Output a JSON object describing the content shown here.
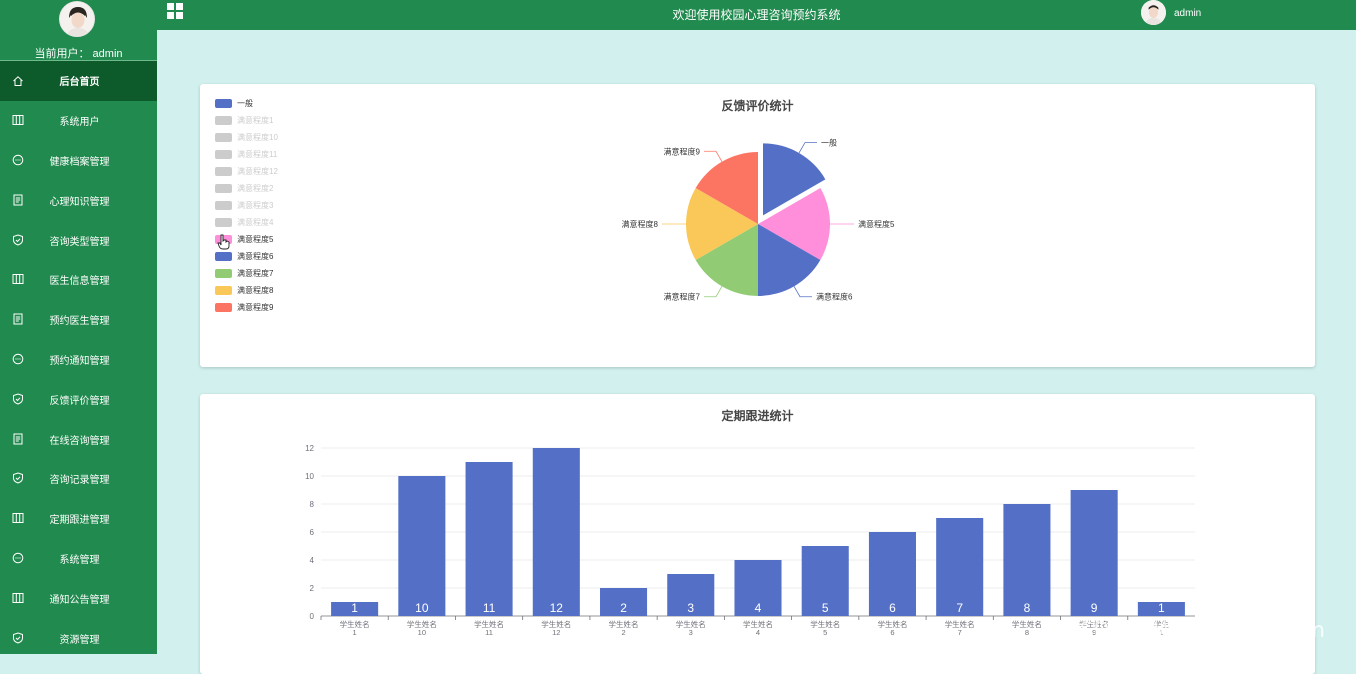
{
  "sidebar": {
    "current_user_label": "当前用户：",
    "current_user_name": "admin",
    "items": [
      {
        "label": "后台首页",
        "icon": "home-icon",
        "active": true
      },
      {
        "label": "系统用户",
        "icon": "columns-icon"
      },
      {
        "label": "健康档案管理",
        "icon": "chat-icon"
      },
      {
        "label": "心理知识管理",
        "icon": "document-icon"
      },
      {
        "label": "咨询类型管理",
        "icon": "shield-icon"
      },
      {
        "label": "医生信息管理",
        "icon": "columns-icon"
      },
      {
        "label": "预约医生管理",
        "icon": "document-icon"
      },
      {
        "label": "预约通知管理",
        "icon": "chat-icon"
      },
      {
        "label": "反馈评价管理",
        "icon": "shield-icon"
      },
      {
        "label": "在线咨询管理",
        "icon": "document-icon"
      },
      {
        "label": "咨询记录管理",
        "icon": "shield-icon"
      },
      {
        "label": "定期跟进管理",
        "icon": "columns-icon"
      },
      {
        "label": "系统管理",
        "icon": "chat-icon"
      },
      {
        "label": "通知公告管理",
        "icon": "columns-icon"
      },
      {
        "label": "资源管理",
        "icon": "shield-icon"
      }
    ]
  },
  "header": {
    "title": "欢迎使用校园心理咨询预约系统",
    "user": "admin"
  },
  "colors": {
    "brand": "#218a4f",
    "brand_dark": "#0d5a2a",
    "background": "#d1f0ee",
    "legend_off": "#cccccc"
  },
  "chart_data": [
    {
      "type": "pie",
      "title": "反馈评价统计",
      "legend_position": "top-left",
      "legend": [
        {
          "name": "一般",
          "color": "#5470c6",
          "active": true
        },
        {
          "name": "满意程度1",
          "color": "#cccccc",
          "active": false
        },
        {
          "name": "满意程度10",
          "color": "#cccccc",
          "active": false
        },
        {
          "name": "满意程度11",
          "color": "#cccccc",
          "active": false
        },
        {
          "name": "满意程度12",
          "color": "#cccccc",
          "active": false
        },
        {
          "name": "满意程度2",
          "color": "#cccccc",
          "active": false
        },
        {
          "name": "满意程度3",
          "color": "#cccccc",
          "active": false
        },
        {
          "name": "满意程度4",
          "color": "#cccccc",
          "active": false
        },
        {
          "name": "满意程度5",
          "color": "#ff8fdb",
          "active": true
        },
        {
          "name": "满意程度6",
          "color": "#5470c6",
          "active": true
        },
        {
          "name": "满意程度7",
          "color": "#91cc75",
          "active": true
        },
        {
          "name": "满意程度8",
          "color": "#fac858",
          "active": true
        },
        {
          "name": "满意程度9",
          "color": "#fc7563",
          "active": true
        }
      ],
      "slices": [
        {
          "name": "一般",
          "value": 1,
          "color": "#5470c6",
          "exploded": true
        },
        {
          "name": "满意程度5",
          "value": 1,
          "color": "#ff8fdb",
          "exploded": false
        },
        {
          "name": "满意程度6",
          "value": 1,
          "color": "#5470c6",
          "exploded": false
        },
        {
          "name": "满意程度7",
          "value": 1,
          "color": "#91cc75",
          "exploded": false
        },
        {
          "name": "满意程度8",
          "value": 1,
          "color": "#fac858",
          "exploded": false
        },
        {
          "name": "满意程度9",
          "value": 1,
          "color": "#fc7563",
          "exploded": false
        }
      ]
    },
    {
      "type": "bar",
      "title": "定期跟进统计",
      "categories": [
        "学生姓名\n1",
        "学生姓名\n10",
        "学生姓名\n11",
        "学生姓名\n12",
        "学生姓名\n2",
        "学生姓名\n3",
        "学生姓名\n4",
        "学生姓名\n5",
        "学生姓名\n6",
        "学生姓名\n7",
        "学生姓名\n8",
        "学生姓名\n9",
        "学生\n1"
      ],
      "values": [
        1,
        10,
        11,
        12,
        2,
        3,
        4,
        5,
        6,
        7,
        8,
        9,
        1
      ],
      "ylim": [
        0,
        12
      ],
      "yticks": [
        0,
        2,
        4,
        6,
        8,
        10,
        12
      ],
      "color": "#5470c6",
      "grid": true
    }
  ],
  "watermark": "CSDN @Wx-Biye_Design"
}
